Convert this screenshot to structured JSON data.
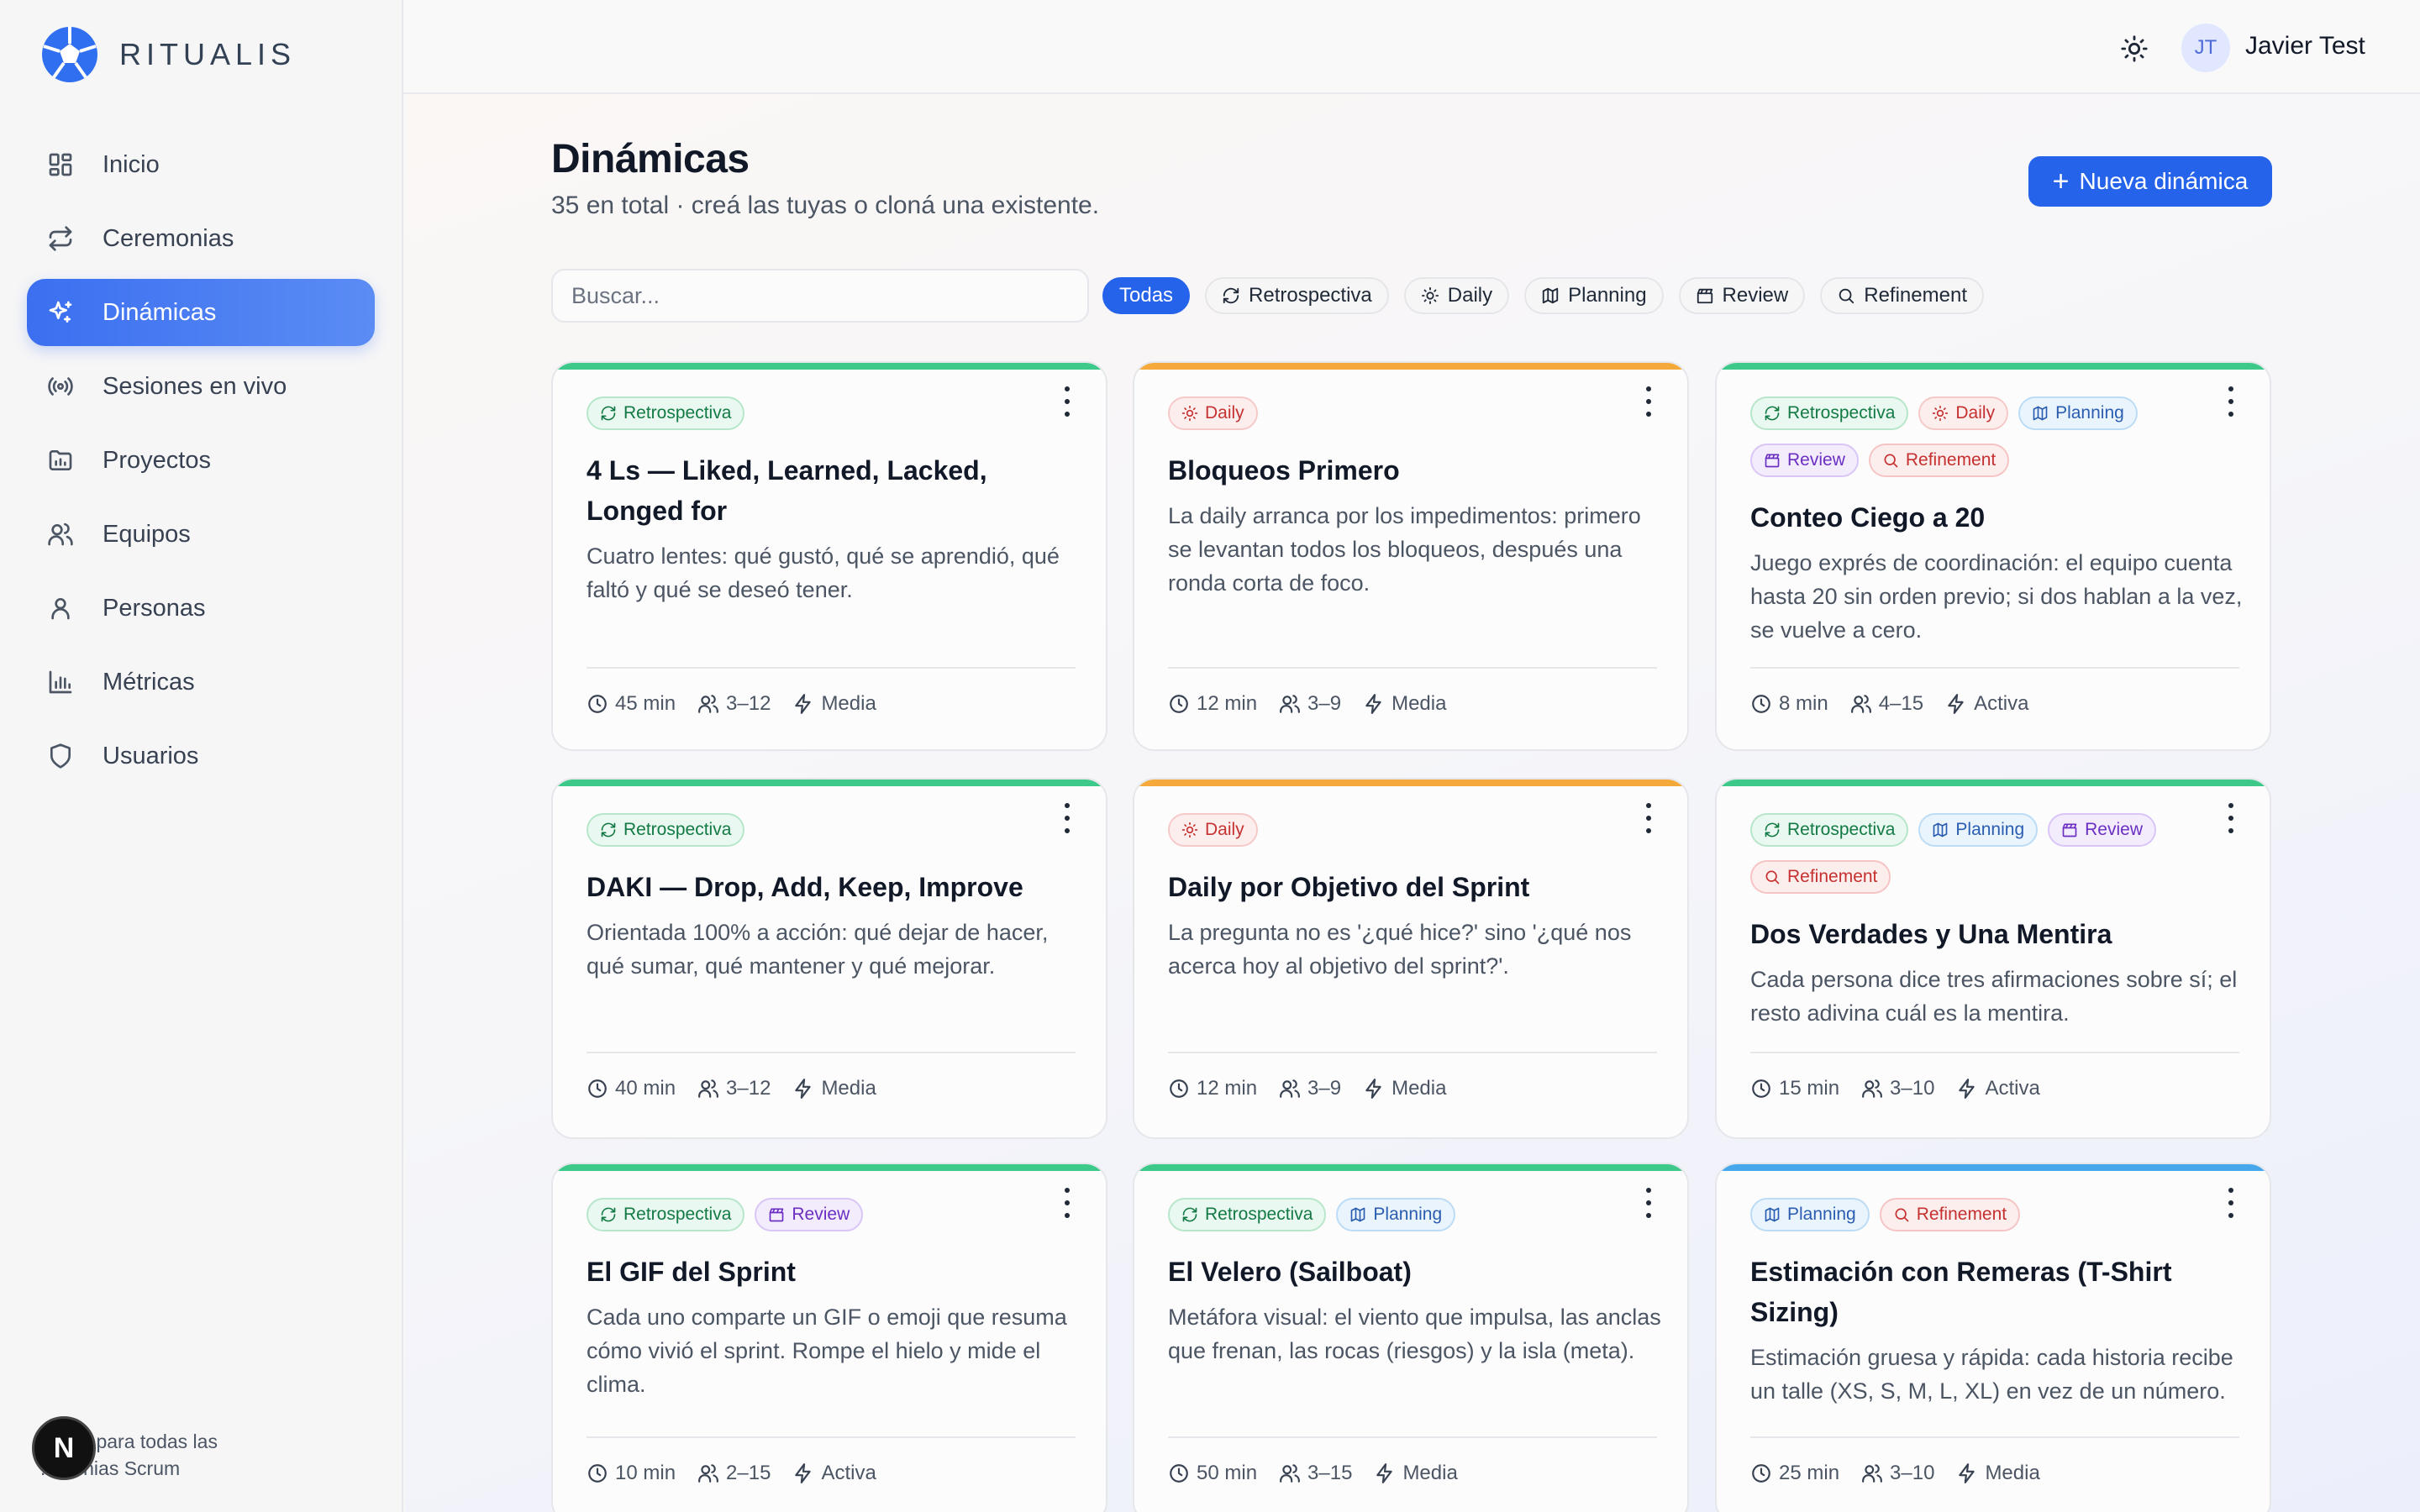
{
  "brand": {
    "name": "RITUALIS"
  },
  "sidebar": {
    "items": [
      {
        "label": "Inicio",
        "icon": "dashboard-icon"
      },
      {
        "label": "Ceremonias",
        "icon": "repeat-icon"
      },
      {
        "label": "Dinámicas",
        "icon": "sparkles-icon",
        "active": true
      },
      {
        "label": "Sesiones en vivo",
        "icon": "broadcast-icon"
      },
      {
        "label": "Proyectos",
        "icon": "folder-chart-icon"
      },
      {
        "label": "Equipos",
        "icon": "users-icon"
      },
      {
        "label": "Personas",
        "icon": "user-icon"
      },
      {
        "label": "Métricas",
        "icon": "bar-chart-icon"
      },
      {
        "label": "Usuarios",
        "icon": "shield-icon"
      }
    ],
    "footer": "...icas para todas las ...monias Scrum",
    "next_badge": "N"
  },
  "topbar": {
    "user_initials": "JT",
    "user_name": "Javier Test"
  },
  "page": {
    "title": "Dinámicas",
    "subtitle": "35 en total · creá las tuyas o cloná una existente.",
    "new_button": "Nueva dinámica",
    "search_placeholder": "Buscar...",
    "filters": [
      "Todas",
      "Retrospectiva",
      "Daily",
      "Planning",
      "Review",
      "Refinement"
    ]
  },
  "cards": [
    {
      "title": "4 Ls — Liked, Learned, Lacked, Longed for",
      "description": "Cuatro lentes: qué gustó, qué se aprendió, qué faltó y qué se deseó tener.",
      "tags": [
        "Retrospectiva"
      ],
      "duration": "45 min",
      "people": "3–12",
      "energy": "Media",
      "accent": "#3cc98a"
    },
    {
      "title": "Bloqueos Primero",
      "description": "La daily arranca por los impedimentos: primero se levantan todos los bloqueos, después una ronda corta de foco.",
      "tags": [
        "Daily"
      ],
      "duration": "12 min",
      "people": "3–9",
      "energy": "Media",
      "accent": "#f5a93b"
    },
    {
      "title": "Conteo Ciego a 20",
      "description": "Juego exprés de coordinación: el equipo cuenta hasta 20 sin orden previo; si dos hablan a la vez, se vuelve a cero.",
      "tags": [
        "Retrospectiva",
        "Daily",
        "Planning",
        "Review",
        "Refinement"
      ],
      "duration": "8 min",
      "people": "4–15",
      "energy": "Activa",
      "accent": "#3cc98a"
    },
    {
      "title": "DAKI — Drop, Add, Keep, Improve",
      "description": "Orientada 100% a acción: qué dejar de hacer, qué sumar, qué mantener y qué mejorar.",
      "tags": [
        "Retrospectiva"
      ],
      "duration": "40 min",
      "people": "3–12",
      "energy": "Media",
      "accent": "#3cc98a"
    },
    {
      "title": "Daily por Objetivo del Sprint",
      "description": "La pregunta no es '¿qué hice?' sino '¿qué nos acerca hoy al objetivo del sprint?'.",
      "tags": [
        "Daily"
      ],
      "duration": "12 min",
      "people": "3–9",
      "energy": "Media",
      "accent": "#f5a93b"
    },
    {
      "title": "Dos Verdades y Una Mentira",
      "description": "Cada persona dice tres afirmaciones sobre sí; el resto adivina cuál es la mentira.",
      "tags": [
        "Retrospectiva",
        "Planning",
        "Review",
        "Refinement"
      ],
      "duration": "15 min",
      "people": "3–10",
      "energy": "Activa",
      "accent": "#3cc98a"
    },
    {
      "title": "El GIF del Sprint",
      "description": "Cada uno comparte un GIF o emoji que resuma cómo vivió el sprint. Rompe el hielo y mide el clima.",
      "tags": [
        "Retrospectiva",
        "Review"
      ],
      "duration": "10 min",
      "people": "2–15",
      "energy": "Activa",
      "accent": "#3cc98a"
    },
    {
      "title": "El Velero (Sailboat)",
      "description": "Metáfora visual: el viento que impulsa, las anclas que frenan, las rocas (riesgos) y la isla (meta).",
      "tags": [
        "Retrospectiva",
        "Planning"
      ],
      "duration": "50 min",
      "people": "3–15",
      "energy": "Media",
      "accent": "#3cc98a"
    },
    {
      "title": "Estimación con Remeras (T-Shirt Sizing)",
      "description": "Estimación gruesa y rápida: cada historia recibe un talle (XS, S, M, L, XL) en vez de un número.",
      "tags": [
        "Planning",
        "Refinement"
      ],
      "duration": "25 min",
      "people": "3–10",
      "energy": "Media",
      "accent": "#46a7ea"
    }
  ]
}
